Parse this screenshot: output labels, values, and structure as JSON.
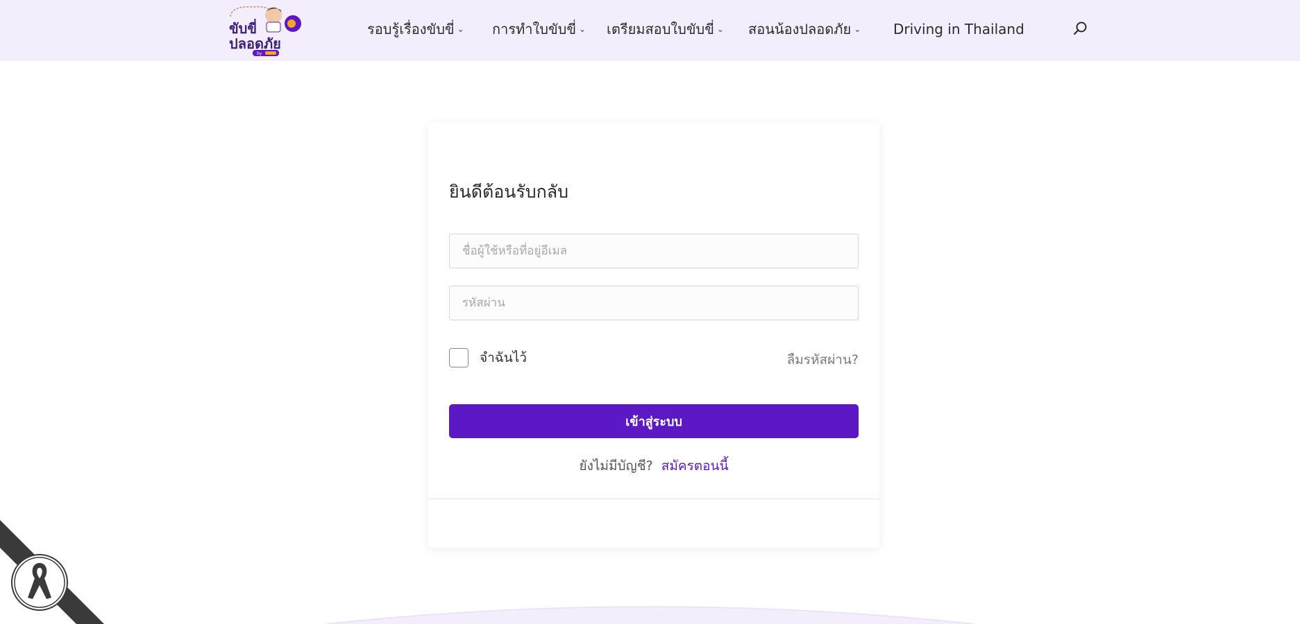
{
  "header": {
    "logo": {
      "line1": "ขับขี่",
      "line2": "ปลอดภัย",
      "badge": "by"
    },
    "nav": [
      {
        "label": "รอบรู้เรื่องขับขี่",
        "has_dropdown": true
      },
      {
        "label": "การทำใบขับขี่",
        "has_dropdown": true
      },
      {
        "label": "เตรียมสอบใบขับขี่",
        "has_dropdown": true
      },
      {
        "label": "สอนน้องปลอดภัย",
        "has_dropdown": true
      },
      {
        "label": "Driving in Thailand",
        "has_dropdown": false
      }
    ],
    "search_icon": "search-icon",
    "dropdown_icon": "chevron-down-icon"
  },
  "login": {
    "title": "ยินดีต้อนรับกลับ",
    "username_placeholder": "ชื่อผู้ใช้หรือที่อยู่อีเมล",
    "username_value": "",
    "password_placeholder": "รหัสผ่าน",
    "password_value": "",
    "remember_label": "จำฉันไว้",
    "remember_checked": false,
    "forgot_label": "ลืมรหัสผ่าน?",
    "submit_label": "เข้าสู่ระบบ",
    "signup_prompt": "ยังไม่มีบัญชี?",
    "signup_link": "สมัครตอนนี้"
  },
  "colors": {
    "header_bg": "#f4eefc",
    "accent": "#5b18c4",
    "ribbon": "#3a3a3a"
  },
  "icons": {
    "mourning_badge": "black-ribbon-icon"
  }
}
